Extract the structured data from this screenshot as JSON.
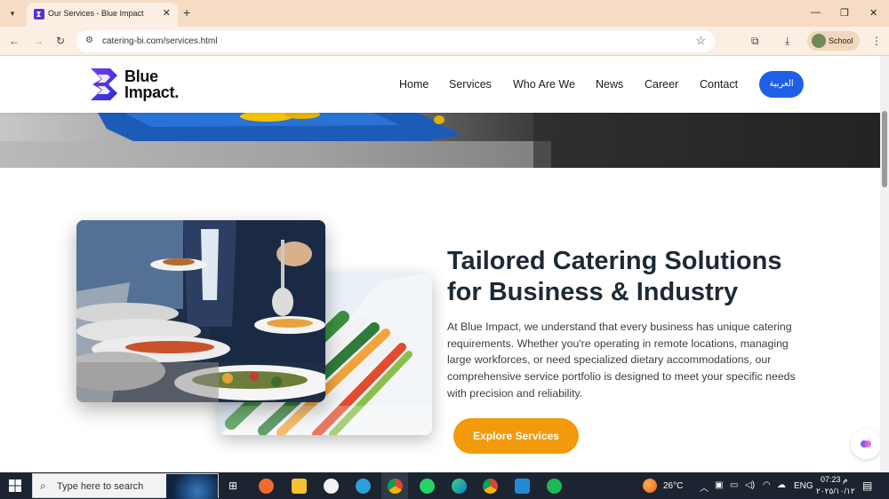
{
  "browser": {
    "tab_title": "Our Services - Blue Impact",
    "tab_close": "✕",
    "new_tab": "+",
    "url": "catering-bi.com/services.html",
    "profile_name": "School"
  },
  "site": {
    "logo_line1": "Blue",
    "logo_line2": "Impact.",
    "nav": [
      "Home",
      "Services",
      "Who Are We",
      "News",
      "Career",
      "Contact"
    ],
    "lang_button": "العربية"
  },
  "section": {
    "title": "Tailored Catering Solutions for Business & Industry",
    "body": "At Blue Impact, we understand that every business has unique catering requirements. Whether you're operating in remote locations, managing large workforces, or need specialized dietary accommodations, our comprehensive service portfolio is designed to meet your specific needs with precision and reliability.",
    "cta": "Explore Services"
  },
  "taskbar": {
    "search_placeholder": "Type here to search",
    "temperature": "26°C",
    "language": "ENG",
    "time": "07:23 م",
    "date": "٢٠٢٥/١٠/١٢"
  },
  "colors": {
    "brand_purple": "#5b2fd6",
    "nav_button_blue": "#1f5fe8",
    "cta_orange": "#f39a0c",
    "heading": "#1d2a36"
  }
}
